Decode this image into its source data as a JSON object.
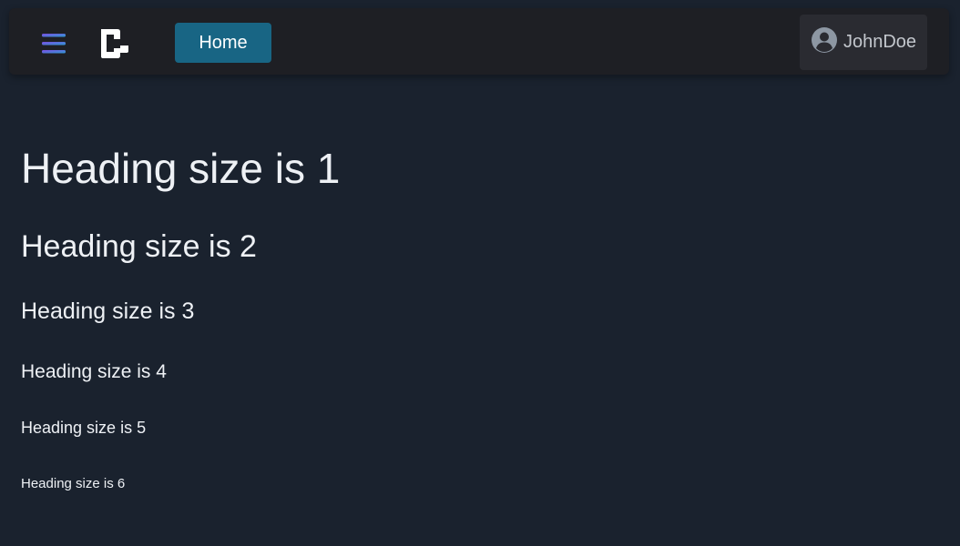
{
  "header": {
    "menu_icon": "hamburger-menu-icon",
    "logo_icon": "app-logo",
    "home_label": "Home",
    "user": {
      "icon": "user-circle-icon",
      "name": "JohnDoe"
    }
  },
  "main": {
    "headings": [
      "Heading size is 1",
      "Heading size is 2",
      "Heading size is 3",
      "Heading size is 4",
      "Heading size is 5",
      "Heading size is 6"
    ]
  },
  "colors": {
    "background": "#1a222e",
    "topbar": "#1e1f24",
    "home_button": "#186584",
    "user_button": "#2a2b31",
    "menu_icon_gradient": [
      "#7b4ce0",
      "#2f9bd6"
    ]
  }
}
